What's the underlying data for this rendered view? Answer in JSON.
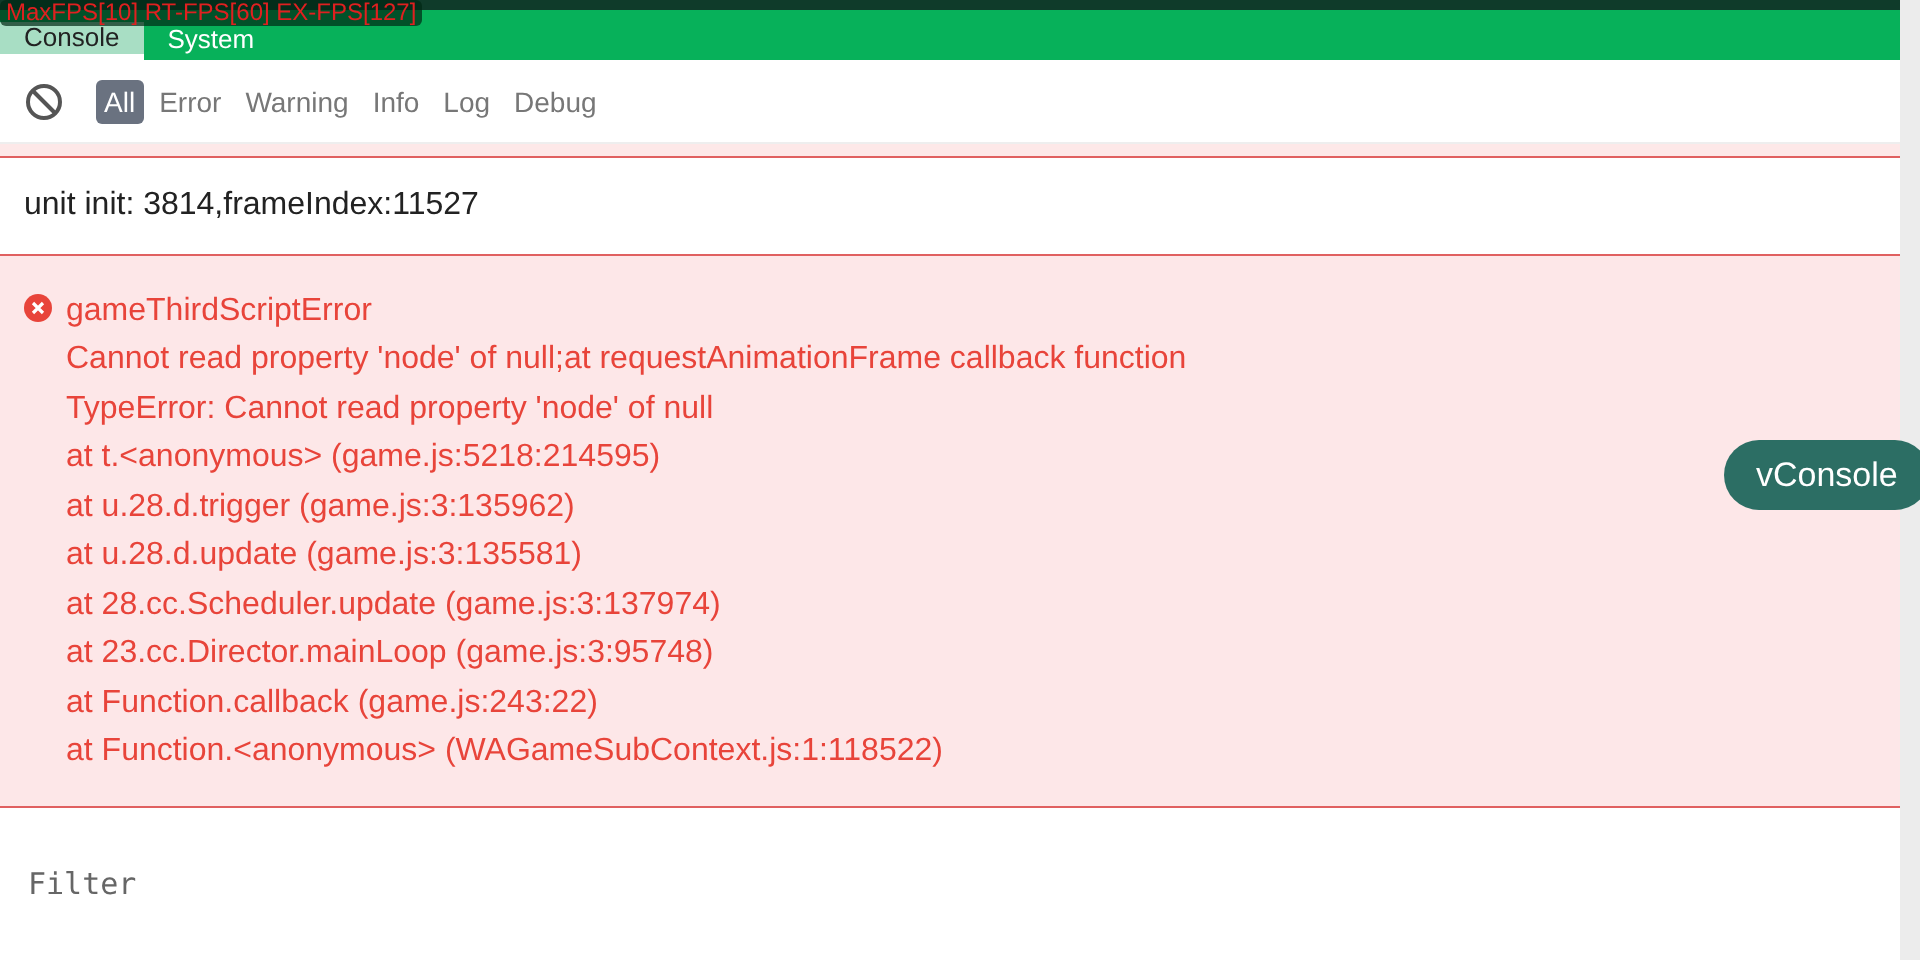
{
  "fps_overlay": "MaxFPS[10] RT-FPS[60] EX-FPS[127]",
  "tabs": [
    {
      "label": "Console",
      "selected": true
    },
    {
      "label": "System",
      "selected": false
    }
  ],
  "filters": [
    {
      "label": "All",
      "selected": true
    },
    {
      "label": "Error",
      "selected": false
    },
    {
      "label": "Warning",
      "selected": false
    },
    {
      "label": "Info",
      "selected": false
    },
    {
      "label": "Log",
      "selected": false
    },
    {
      "label": "Debug",
      "selected": false
    }
  ],
  "logs": [
    {
      "kind": "log",
      "lines": [
        "unit init: 3814,frameIndex:11527"
      ]
    },
    {
      "kind": "error",
      "lines": [
        "gameThirdScriptError",
        "Cannot read property 'node' of null;at requestAnimationFrame callback function",
        "TypeError: Cannot read property 'node' of null",
        "at t.<anonymous> (game.js:5218:214595)",
        "at u.28.d.trigger (game.js:3:135962)",
        "at u.28.d.update (game.js:3:135581)",
        "at 28.cc.Scheduler.update (game.js:3:137974)",
        "at 23.cc.Director.mainLoop (game.js:3:95748)",
        "at Function.callback (game.js:243:22)",
        "at Function.<anonymous> (WAGameSubContext.js:1:118522)"
      ]
    }
  ],
  "filter": {
    "placeholder": "Filter"
  },
  "floating_button": "vConsole"
}
